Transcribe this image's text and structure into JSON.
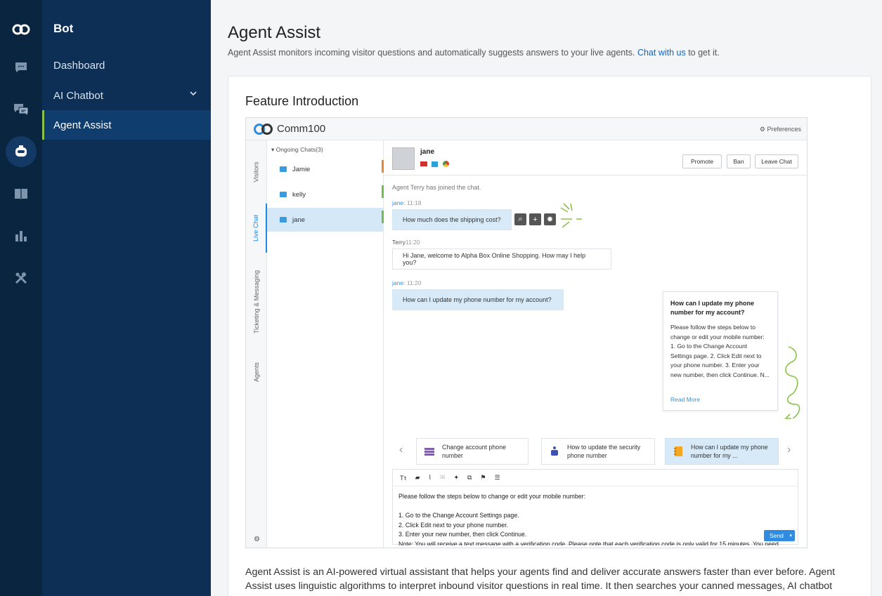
{
  "rail": {
    "items": [
      {
        "icon": "logo-icon"
      },
      {
        "icon": "chat-bubble-icon"
      },
      {
        "icon": "messages-icon"
      },
      {
        "icon": "bot-icon"
      },
      {
        "icon": "book-icon"
      },
      {
        "icon": "bar-chart-icon"
      },
      {
        "icon": "tools-icon"
      }
    ]
  },
  "subnav": {
    "title": "Bot",
    "items": [
      {
        "label": "Dashboard"
      },
      {
        "label": "AI Chatbot"
      },
      {
        "label": "Agent Assist"
      }
    ]
  },
  "page": {
    "title": "Agent Assist",
    "desc": "Agent Assist monitors incoming visitor questions and automatically suggests answers to your live agents.",
    "link": "Chat with us",
    "desc_end": "to get it."
  },
  "card": {
    "title": "Feature Introduction",
    "text": "Agent Assist is an AI-powered virtual assistant that helps your agents find and deliver accurate answers faster than ever before. Agent Assist uses linguistic algorithms to interpret inbound visitor questions in real time. It then searches your canned messages, AI chatbot intents and knowledge base articles for relevant answers and presents the best ones to your agents."
  },
  "shot": {
    "brand": "Comm100",
    "preferences": "Preferences",
    "tabs": [
      "Visitors",
      "Live Chat",
      "Ticketing & Messaging",
      "Agents"
    ],
    "ongoing": "Ongoing Chats(3)",
    "chats": [
      "Jamie",
      "kelly",
      "jane"
    ],
    "visitor": "jane",
    "buttons": {
      "promote": "Promote",
      "ban": "Ban",
      "leave": "Leave Chat"
    },
    "system_msg": "Agent Terry has joined the chat.",
    "messages": [
      {
        "who": "jane:",
        "time": "11:18",
        "text": "How much does the shipping cost?"
      },
      {
        "who": "Terry",
        "time": "11:20",
        "text": "Hi Jane, welcome to Alpha Box Online Shopping. How may I help you?"
      },
      {
        "who": "jane:",
        "time": "11:20",
        "text": "How can I update my phone number for my account?"
      }
    ],
    "popup": {
      "question": "How can I update my phone number for my account?",
      "answer": "Please follow the steps below to change or edit your mobile number: 1. Go to the Change Account Settings page. 2. Click Edit next to your phone number. 3. Enter your new number, then click Continue. N...",
      "more": "Read More"
    },
    "suggestions": [
      {
        "text": "Change account phone number"
      },
      {
        "text": "How to update the security phone number"
      },
      {
        "text": "How can I update my phone number for my ..."
      }
    ],
    "editor_text": "Please follow the steps below to change or edit your mobile number:\n\n1. Go to the Change Account Settings page.\n2. Click Edit next to your phone number.\n3. Enter your new number, then click Continue.\nNote: You will receive a text message with a verification code. Please note that each verification code is only valid for 15 minutes. You need",
    "send": "Send"
  },
  "colors": {
    "rail_bg": "#0a2540",
    "subnav_bg": "#0d2f55",
    "active_accent": "#8bc34a",
    "link": "#1565c0"
  }
}
